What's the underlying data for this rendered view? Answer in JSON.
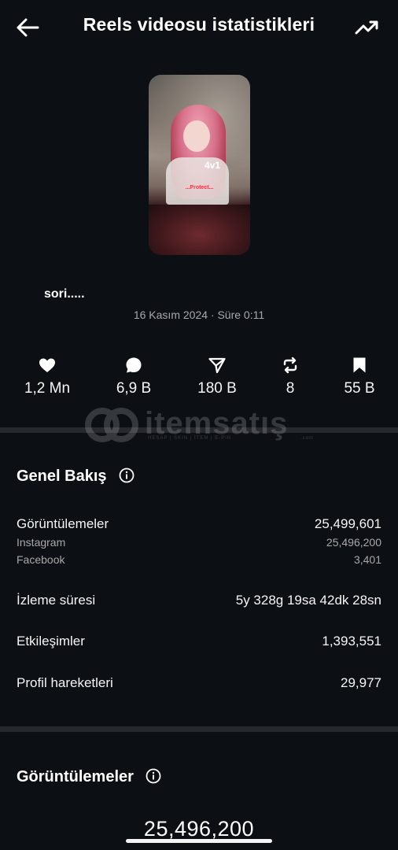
{
  "header": {
    "title": "Reels videosu istatistikleri",
    "back_icon": "arrow-left-icon",
    "trend_icon": "trending-up-icon"
  },
  "reel": {
    "thumbnail_overlay_text": "4v1",
    "thumbnail_caption_text": "...Protect...",
    "caption": "sori.....",
    "meta": "16 Kasım 2024 · Süre 0:11"
  },
  "stats": [
    {
      "icon": "heart-icon",
      "value": "1,2 Mn"
    },
    {
      "icon": "comment-icon",
      "value": "6,9 B"
    },
    {
      "icon": "share-icon",
      "value": "180 B"
    },
    {
      "icon": "repost-icon",
      "value": "8"
    },
    {
      "icon": "bookmark-icon",
      "value": "55 B"
    }
  ],
  "watermark": {
    "text": "itemsatış",
    "subtext": "HESAP | SKIN | İTEM | E-PIN",
    "suffix": ".com"
  },
  "overview": {
    "title": "Genel Bakış",
    "views_label": "Görüntülemeler",
    "views_value": "25,499,601",
    "instagram_label": "Instagram",
    "instagram_value": "25,496,200",
    "facebook_label": "Facebook",
    "facebook_value": "3,401",
    "watch_time_label": "İzleme süresi",
    "watch_time_value": "5y 328g 19sa 42dk 28sn",
    "interactions_label": "Etkileşimler",
    "interactions_value": "1,393,551",
    "profile_label": "Profil hareketleri",
    "profile_value": "29,977"
  },
  "views_section": {
    "title": "Görüntülemeler",
    "total": "25,496,200"
  },
  "colors": {
    "background": "#0c1014",
    "divider": "#26292e",
    "text_primary": "#f5f5f5",
    "text_secondary": "#a8a8a8"
  }
}
